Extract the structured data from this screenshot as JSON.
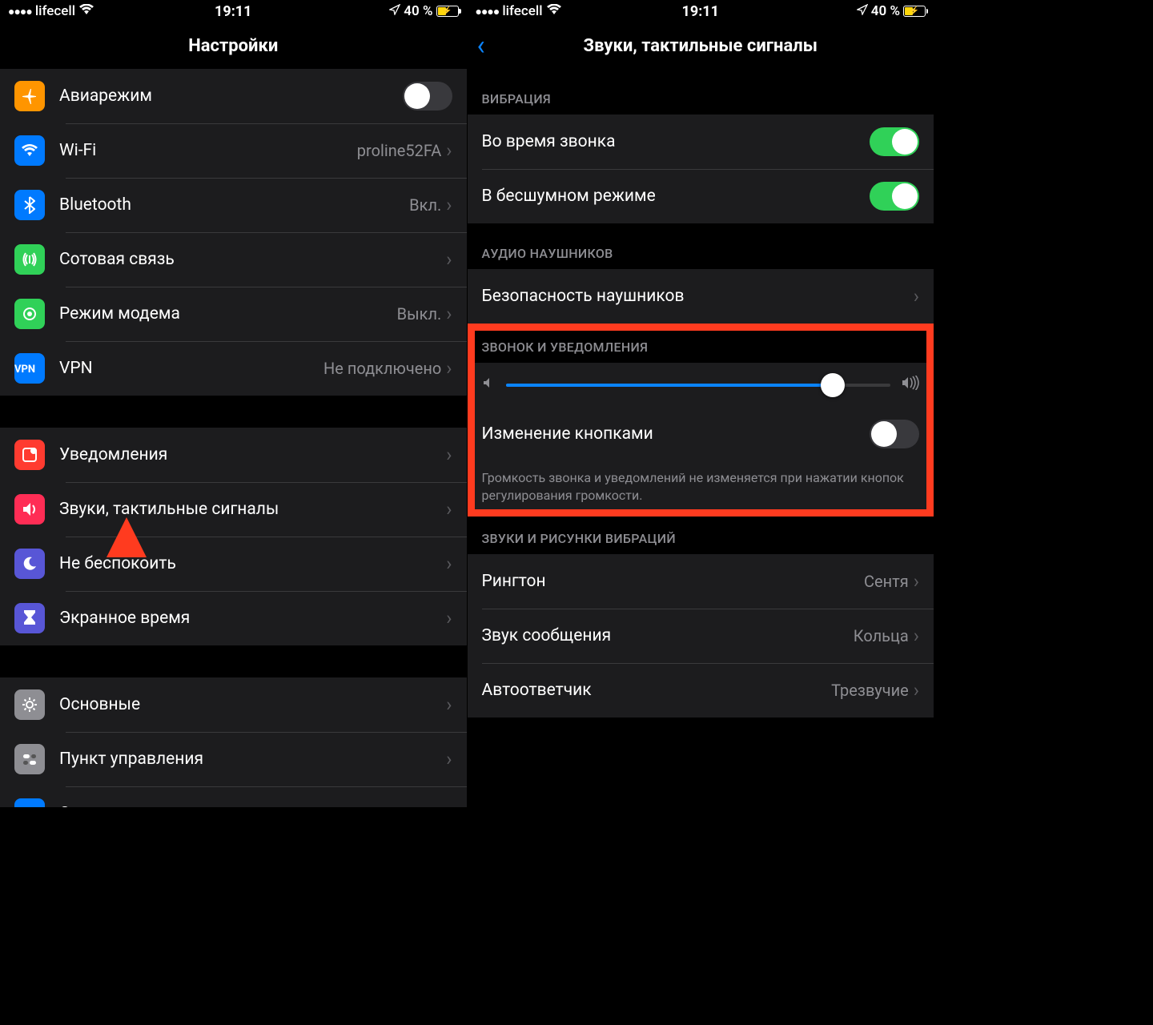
{
  "status": {
    "carrier": "lifecell",
    "time": "19:11",
    "battery_pct": "40 %"
  },
  "left": {
    "title": "Настройки",
    "gA": [
      {
        "icon": "airplane",
        "bg": "#ff9500",
        "label": "Авиарежим",
        "toggle": false
      },
      {
        "icon": "wifi",
        "bg": "#007aff",
        "label": "Wi-Fi",
        "value": "proline52FA"
      },
      {
        "icon": "bluetooth",
        "bg": "#007aff",
        "label": "Bluetooth",
        "value": "Вкл."
      },
      {
        "icon": "cellular",
        "bg": "#30d158",
        "label": "Сотовая связь",
        "value": ""
      },
      {
        "icon": "hotspot",
        "bg": "#30d158",
        "label": "Режим модема",
        "value": "Выкл."
      },
      {
        "icon": "vpn",
        "bg": "#007aff",
        "label": "VPN",
        "value": "Не подключено"
      }
    ],
    "gB": [
      {
        "icon": "notifications",
        "bg": "#ff3b30",
        "label": "Уведомления"
      },
      {
        "icon": "sounds",
        "bg": "#ff2d55",
        "label": "Звуки, тактильные сигналы"
      },
      {
        "icon": "dnd",
        "bg": "#5856d6",
        "label": "Не беспокоить"
      },
      {
        "icon": "screentime",
        "bg": "#5856d6",
        "label": "Экранное время"
      }
    ],
    "gC": [
      {
        "icon": "general",
        "bg": "#8e8e93",
        "label": "Основные"
      },
      {
        "icon": "control",
        "bg": "#8e8e93",
        "label": "Пункт управления"
      },
      {
        "icon": "display",
        "bg": "#007aff",
        "label": "Экран и яркость"
      }
    ]
  },
  "right": {
    "title": "Звуки, тактильные сигналы",
    "sec_vibration": "ВИБРАЦИЯ",
    "vibration_rows": [
      {
        "label": "Во время звонка",
        "toggle": true
      },
      {
        "label": "В бесшумном режиме",
        "toggle": true
      }
    ],
    "sec_headphone": "АУДИО НАУШНИКОВ",
    "headphone_row": {
      "label": "Безопасность наушников"
    },
    "sec_ringer": "ЗВОНОК И УВЕДОМЛЕНИЯ",
    "ringer_slider_value": 85,
    "ringer_change_label": "Изменение кнопками",
    "ringer_change_toggle": false,
    "ringer_footer": "Громкость звонка и уведомлений не изменяется при нажатии кнопок регулирования громкости.",
    "sec_patterns": "ЗВУКИ И РИСУНКИ ВИБРАЦИЙ",
    "pattern_rows": [
      {
        "label": "Рингтон",
        "value": "Сентя"
      },
      {
        "label": "Звук сообщения",
        "value": "Кольца"
      },
      {
        "label": "Автоответчик",
        "value": "Трезвучие"
      }
    ]
  }
}
